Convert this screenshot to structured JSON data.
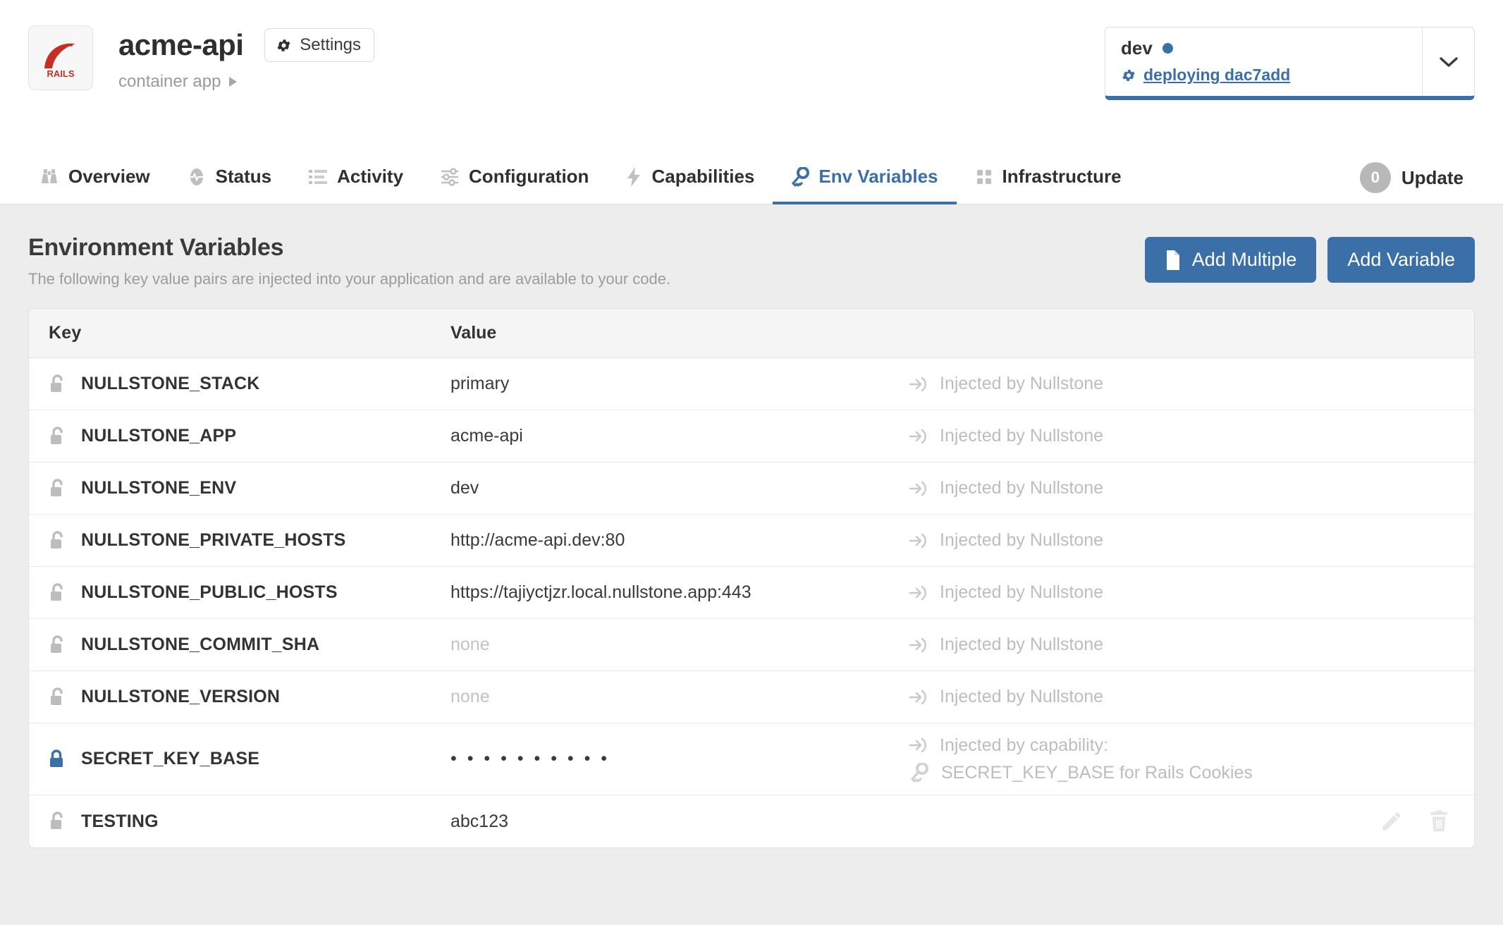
{
  "header": {
    "logo_alt": "rails-logo",
    "app_name": "acme-api",
    "settings_label": "Settings",
    "app_type": "container app"
  },
  "env_selector": {
    "env_name": "dev",
    "status_icon": "gear-icon",
    "status_text": "deploying dac7add",
    "chevron": "chevron-down-icon",
    "accent_color": "#3b6fa8"
  },
  "nav": {
    "tabs": [
      {
        "label": "Overview",
        "icon": "binoculars-icon",
        "active": false
      },
      {
        "label": "Status",
        "icon": "pulse-icon",
        "active": false
      },
      {
        "label": "Activity",
        "icon": "list-icon",
        "active": false
      },
      {
        "label": "Configuration",
        "icon": "sliders-icon",
        "active": false
      },
      {
        "label": "Capabilities",
        "icon": "bolt-icon",
        "active": false
      },
      {
        "label": "Env Variables",
        "icon": "key-icon",
        "active": true
      },
      {
        "label": "Infrastructure",
        "icon": "grid-icon",
        "active": false
      }
    ],
    "update": {
      "count": "0",
      "label": "Update"
    }
  },
  "section": {
    "title": "Environment Variables",
    "subtitle": "The following key value pairs are injected into your application and are available to your code.",
    "add_multiple_label": "Add Multiple",
    "add_variable_label": "Add Variable"
  },
  "table": {
    "columns": {
      "key": "Key",
      "value": "Value"
    },
    "rows": [
      {
        "lock": "unlocked",
        "key": "NULLSTONE_STACK",
        "value": "primary",
        "value_muted": false,
        "note": "Injected by Nullstone",
        "note2": "",
        "actions": false
      },
      {
        "lock": "unlocked",
        "key": "NULLSTONE_APP",
        "value": "acme-api",
        "value_muted": false,
        "note": "Injected by Nullstone",
        "note2": "",
        "actions": false
      },
      {
        "lock": "unlocked",
        "key": "NULLSTONE_ENV",
        "value": "dev",
        "value_muted": false,
        "note": "Injected by Nullstone",
        "note2": "",
        "actions": false
      },
      {
        "lock": "unlocked",
        "key": "NULLSTONE_PRIVATE_HOSTS",
        "value": "http://acme-api.dev:80",
        "value_muted": false,
        "note": "Injected by Nullstone",
        "note2": "",
        "actions": false
      },
      {
        "lock": "unlocked",
        "key": "NULLSTONE_PUBLIC_HOSTS",
        "value": "https://tajiyctjzr.local.nullstone.app:443",
        "value_muted": false,
        "note": "Injected by Nullstone",
        "note2": "",
        "actions": false
      },
      {
        "lock": "unlocked",
        "key": "NULLSTONE_COMMIT_SHA",
        "value": "none",
        "value_muted": true,
        "note": "Injected by Nullstone",
        "note2": "",
        "actions": false
      },
      {
        "lock": "unlocked",
        "key": "NULLSTONE_VERSION",
        "value": "none",
        "value_muted": true,
        "note": "Injected by Nullstone",
        "note2": "",
        "actions": false
      },
      {
        "lock": "locked",
        "key": "SECRET_KEY_BASE",
        "value": "• • • • • • • • • •",
        "value_muted": false,
        "note": "Injected by capability:",
        "note2": "SECRET_KEY_BASE for Rails Cookies",
        "actions": false
      },
      {
        "lock": "unlocked",
        "key": "TESTING",
        "value": "abc123",
        "value_muted": false,
        "note": "",
        "note2": "",
        "actions": true
      }
    ]
  },
  "icons": {
    "edit": "pencil-icon",
    "delete": "trash-icon"
  }
}
